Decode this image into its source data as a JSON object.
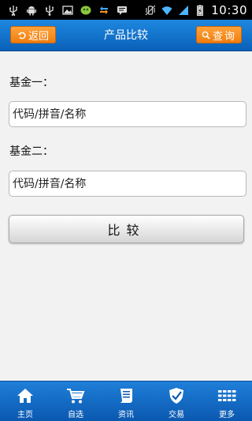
{
  "status_bar": {
    "time": "10:30",
    "icons": [
      "usb-icon",
      "android-icon",
      "usb-icon",
      "image-icon",
      "app-icon",
      "sync-icon",
      "message-icon",
      "vibrate-icon",
      "wifi-icon",
      "signal-icon",
      "battery-charging-icon"
    ]
  },
  "header": {
    "title": "产品比较",
    "back_label": "返回",
    "search_label": "查询"
  },
  "form": {
    "fund1_label": "基金一：",
    "fund1_placeholder": "代码/拼音/名称",
    "fund2_label": "基金二：",
    "fund2_placeholder": "代码/拼音/名称",
    "compare_label": "比较"
  },
  "bottom_nav": {
    "items": [
      {
        "label": "主页",
        "icon": "home-icon"
      },
      {
        "label": "自选",
        "icon": "cart-icon"
      },
      {
        "label": "资讯",
        "icon": "news-icon"
      },
      {
        "label": "交易",
        "icon": "shield-icon"
      },
      {
        "label": "更多",
        "icon": "grid-icon"
      }
    ]
  },
  "colors": {
    "header_blue": "#0a60b8",
    "accent_orange": "#f07d0e",
    "background": "#f2f2f2"
  }
}
